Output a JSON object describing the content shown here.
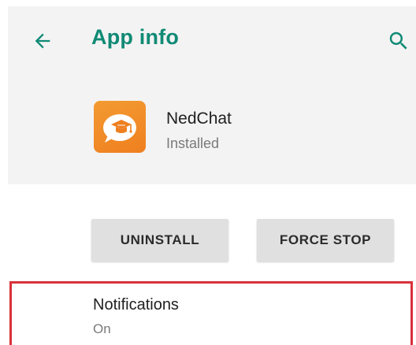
{
  "app_bar": {
    "title": "App info",
    "back_icon": "arrow-back-icon",
    "search_icon": "search-icon",
    "accent_color": "#108a75"
  },
  "app": {
    "name": "NedChat",
    "status": "Installed",
    "icon": "nedchat-app-icon"
  },
  "actions": {
    "uninstall_label": "UNINSTALL",
    "force_stop_label": "FORCE STOP"
  },
  "settings": {
    "notifications": {
      "title": "Notifications",
      "value": "On"
    }
  },
  "highlight_color": "#d9303a"
}
